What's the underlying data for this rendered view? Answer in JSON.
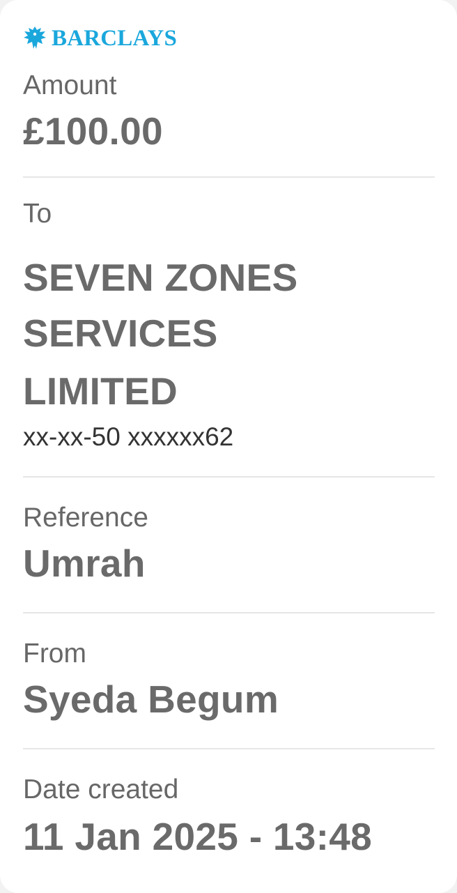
{
  "brand": {
    "name": "BARCLAYS",
    "icon": "barclays-eagle-icon",
    "color": "#1aa7dc"
  },
  "amount": {
    "label": "Amount",
    "value": "£100.00"
  },
  "to": {
    "label": "To",
    "name_line1": "SEVEN ZONES SERVICES",
    "name_line2": "LIMITED",
    "account": "xx-xx-50 xxxxxx62"
  },
  "reference": {
    "label": "Reference",
    "value": "Umrah"
  },
  "from": {
    "label": "From",
    "value": "Syeda Begum"
  },
  "date_created": {
    "label": "Date created",
    "value": "11 Jan 2025 - 13:48"
  }
}
